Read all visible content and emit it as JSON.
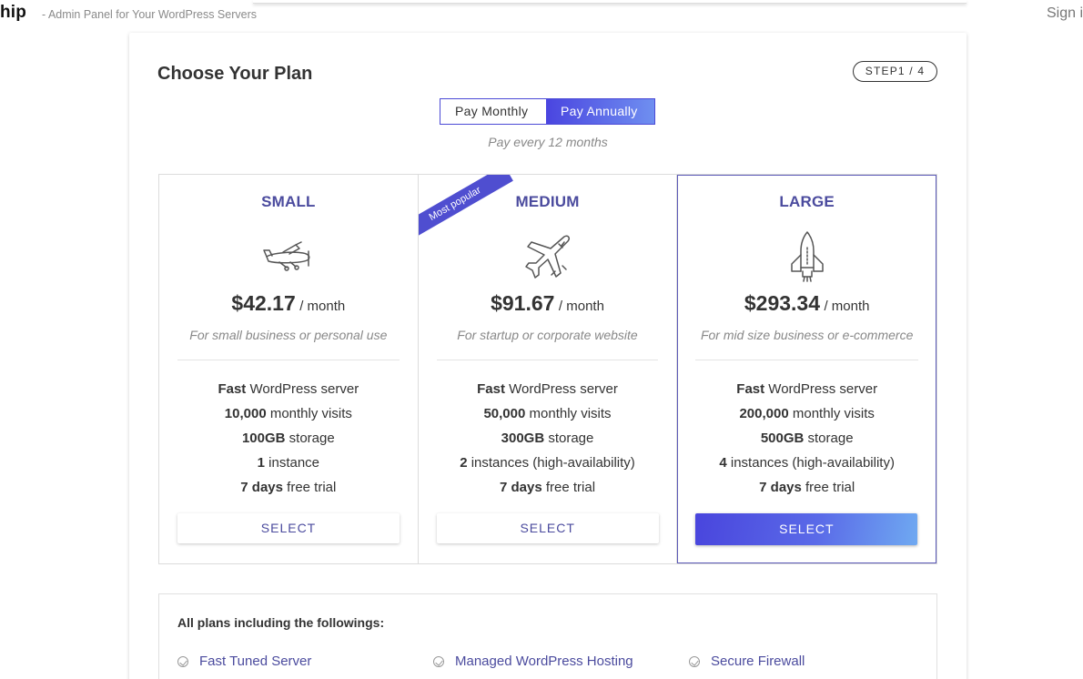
{
  "header": {
    "brand": "hip",
    "tagline": "- Admin Panel for Your WordPress Servers",
    "signin": "Sign i"
  },
  "card": {
    "title": "Choose Your Plan",
    "step": "STEP1 / 4",
    "toggle": {
      "monthly": "Pay Monthly",
      "annually": "Pay Annually",
      "selected": "annually"
    },
    "pay_note": "Pay every 12 months"
  },
  "plans": [
    {
      "name": "SMALL",
      "icon": "biplane-icon",
      "price": "$42.17",
      "per": "/ month",
      "desc": "For small business or personal use",
      "features": [
        {
          "bold": "Fast",
          "rest": " WordPress server"
        },
        {
          "bold": "10,000",
          "rest": " monthly visits"
        },
        {
          "bold": "100GB",
          "rest": " storage"
        },
        {
          "bold": "1",
          "rest": " instance"
        },
        {
          "bold": "7 days",
          "rest": " free trial"
        }
      ],
      "button": "SELECT"
    },
    {
      "name": "MEDIUM",
      "icon": "jet-plane-icon",
      "ribbon": "Most popular",
      "price": "$91.67",
      "per": "/ month",
      "desc": "For startup or corporate website",
      "features": [
        {
          "bold": "Fast",
          "rest": " WordPress server"
        },
        {
          "bold": "50,000",
          "rest": " monthly visits"
        },
        {
          "bold": "300GB",
          "rest": " storage"
        },
        {
          "bold": "2",
          "rest": " instances (high-availability)"
        },
        {
          "bold": "7 days",
          "rest": " free trial"
        }
      ],
      "button": "SELECT"
    },
    {
      "name": "LARGE",
      "icon": "space-shuttle-icon",
      "price": "$293.34",
      "per": "/ month",
      "desc": "For mid size business or e-commerce",
      "features": [
        {
          "bold": "Fast",
          "rest": " WordPress server"
        },
        {
          "bold": "200,000",
          "rest": " monthly visits"
        },
        {
          "bold": "500GB",
          "rest": " storage"
        },
        {
          "bold": "4",
          "rest": " instances (high-availability)"
        },
        {
          "bold": "7 days",
          "rest": " free trial"
        }
      ],
      "button": "SELECT",
      "selected": true
    }
  ],
  "includes": {
    "title": "All plans including the followings:",
    "items": [
      "Fast Tuned Server",
      "Managed WordPress Hosting",
      "Secure Firewall"
    ]
  },
  "colors": {
    "accent": "#4b4b9e",
    "primary": "#4a45e0",
    "primary_end": "#6fa9f1"
  }
}
